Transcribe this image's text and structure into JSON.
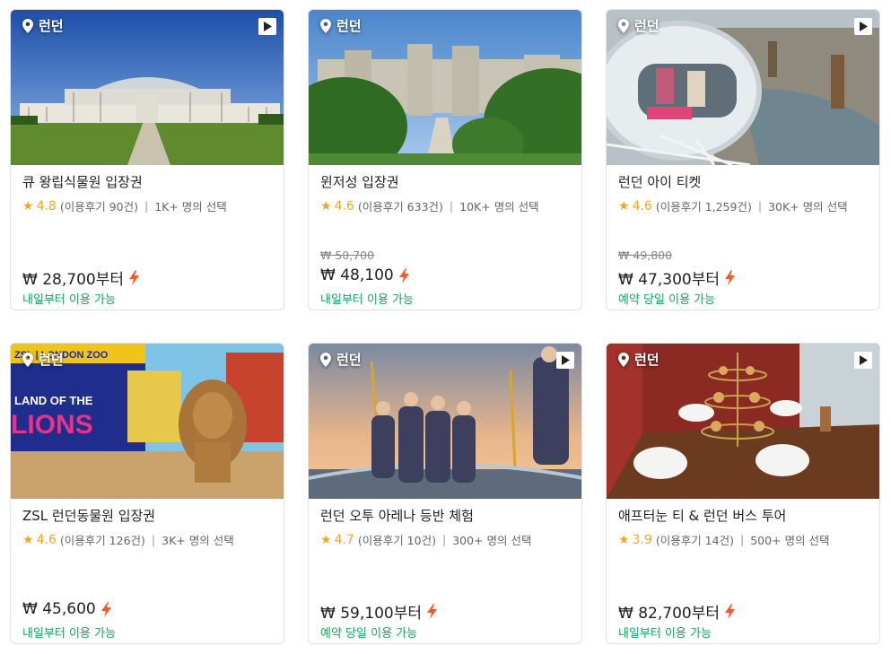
{
  "products": [
    {
      "location": "런던",
      "title": "큐 왕립식물원 입장권",
      "rating": "4.8",
      "reviews": "(이용후기 90건)",
      "selected": "1K+ 명의 선택",
      "original_price": "",
      "price": "₩ 28,700부터",
      "availability": "내일부터 이용 가능",
      "has_video": true
    },
    {
      "location": "런던",
      "title": "윈저성 입장권",
      "rating": "4.6",
      "reviews": "(이용후기 633건)",
      "selected": "10K+ 명의 선택",
      "original_price": "₩ 50,700",
      "price": "₩ 48,100",
      "availability": "내일부터 이용 가능",
      "has_video": false
    },
    {
      "location": "런던",
      "title": "런던 아이 티켓",
      "rating": "4.6",
      "reviews": "(이용후기 1,259건)",
      "selected": "30K+ 명의 선택",
      "original_price": "₩ 49,800",
      "price": "₩ 47,300부터",
      "availability": "예약 당일 이용 가능",
      "has_video": true
    },
    {
      "location": "런던",
      "title": "ZSL 런던동물원 입장권",
      "rating": "4.6",
      "reviews": "(이용후기 126건)",
      "selected": "3K+ 명의 선택",
      "original_price": "",
      "price": "₩ 45,600",
      "availability": "내일부터 이용 가능",
      "has_video": false,
      "image_text": [
        "ZSL | LONDON ZOO",
        "LAND OF THE",
        "LIONS"
      ]
    },
    {
      "location": "런던",
      "title": "런던 오투 아레나 등반 체험",
      "rating": "4.7",
      "reviews": "(이용후기 10건)",
      "selected": "300+ 명의 선택",
      "original_price": "",
      "price": "₩ 59,100부터",
      "availability": "예약 당일 이용 가능",
      "has_video": true
    },
    {
      "location": "런던",
      "title": "애프터눈 티 & 런던 버스 투어",
      "rating": "3.9",
      "reviews": "(이용후기 14건)",
      "selected": "500+ 명의 선택",
      "original_price": "",
      "price": "₩ 82,700부터",
      "availability": "내일부터 이용 가능",
      "has_video": true
    }
  ],
  "colors": {
    "rating": "#f5a623",
    "availability": "#1aa260",
    "bolt": "#ff5722"
  },
  "icons": {
    "location": "map-pin-icon",
    "video": "play-icon",
    "rating": "star-icon",
    "instant": "lightning-bolt-icon"
  }
}
